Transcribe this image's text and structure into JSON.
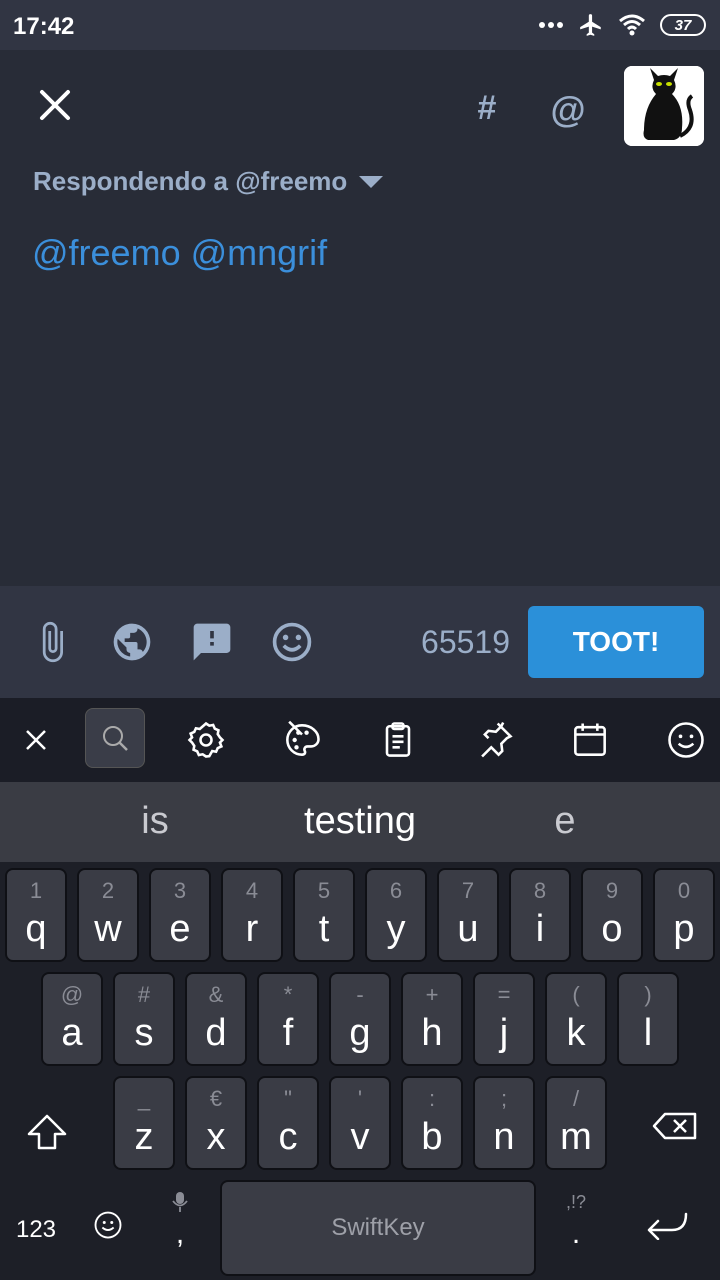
{
  "status_bar": {
    "time": "17:42",
    "battery": "37",
    "icons": [
      "more-dots-icon",
      "airplane-icon",
      "wifi-icon",
      "battery-icon"
    ]
  },
  "compose": {
    "hashtag_label": "#",
    "mention_label": "@",
    "reply_to": "Respondendo a @freemo",
    "text": "@freemo @mngrif"
  },
  "toolbar": {
    "icons": [
      "attach-icon",
      "visibility-globe-icon",
      "content-warning-icon",
      "emoji-icon"
    ],
    "char_count": "65519",
    "toot_label": "TOOT!"
  },
  "keyboard_toolbar": {
    "icons": [
      "close-icon",
      "search-icon",
      "settings-icon",
      "theme-palette-icon",
      "clipboard-icon",
      "pin-icon",
      "calendar-icon",
      "emoji-icon"
    ]
  },
  "suggestions": [
    "is",
    "testing",
    "e"
  ],
  "keyboard": {
    "row1": [
      {
        "pri": "q",
        "sec": "1"
      },
      {
        "pri": "w",
        "sec": "2"
      },
      {
        "pri": "e",
        "sec": "3"
      },
      {
        "pri": "r",
        "sec": "4"
      },
      {
        "pri": "t",
        "sec": "5"
      },
      {
        "pri": "y",
        "sec": "6"
      },
      {
        "pri": "u",
        "sec": "7"
      },
      {
        "pri": "i",
        "sec": "8"
      },
      {
        "pri": "o",
        "sec": "9"
      },
      {
        "pri": "p",
        "sec": "0"
      }
    ],
    "row2": [
      {
        "pri": "a",
        "sec": "@"
      },
      {
        "pri": "s",
        "sec": "#"
      },
      {
        "pri": "d",
        "sec": "&"
      },
      {
        "pri": "f",
        "sec": "*"
      },
      {
        "pri": "g",
        "sec": "-"
      },
      {
        "pri": "h",
        "sec": "+"
      },
      {
        "pri": "j",
        "sec": "="
      },
      {
        "pri": "k",
        "sec": "("
      },
      {
        "pri": "l",
        "sec": ")"
      }
    ],
    "row3": [
      {
        "pri": "z",
        "sec": "_"
      },
      {
        "pri": "x",
        "sec": "€"
      },
      {
        "pri": "c",
        "sec": "\""
      },
      {
        "pri": "v",
        "sec": "'"
      },
      {
        "pri": "b",
        "sec": ":"
      },
      {
        "pri": "n",
        "sec": ";"
      },
      {
        "pri": "m",
        "sec": "/"
      }
    ],
    "numbers_label": "123",
    "comma_label": ",",
    "period_label": ".",
    "punct_hint": ",!?",
    "space_brand": "SwiftKey"
  }
}
